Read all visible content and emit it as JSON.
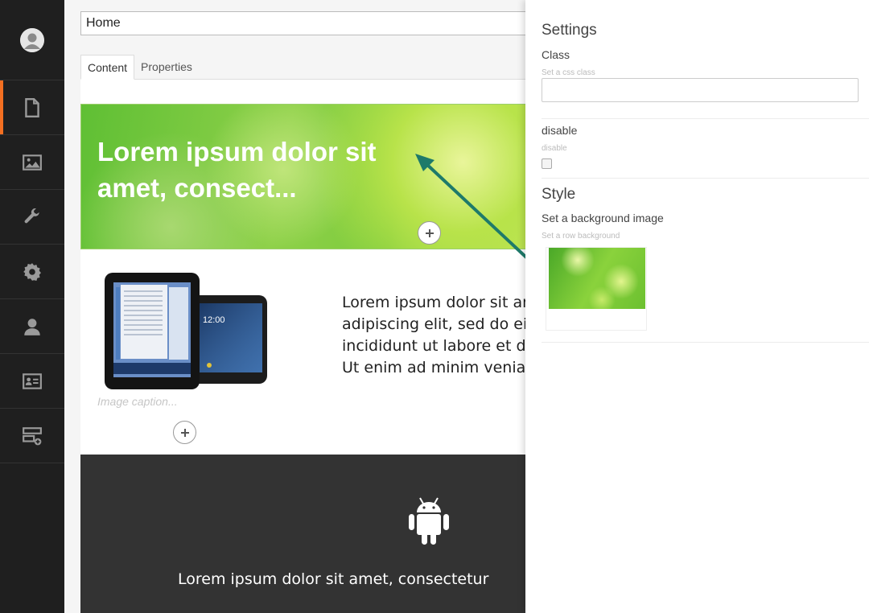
{
  "page": {
    "name_value": "Home",
    "tabs": [
      {
        "label": "Content"
      },
      {
        "label": "Properties"
      }
    ]
  },
  "sidebar": {
    "items": [
      {
        "icon": "document-icon"
      },
      {
        "icon": "image-icon"
      },
      {
        "icon": "wrench-icon"
      },
      {
        "icon": "gear-icon"
      },
      {
        "icon": "user-icon"
      },
      {
        "icon": "id-card-icon"
      },
      {
        "icon": "add-form-icon"
      }
    ],
    "accent_color": "#f36f21"
  },
  "content": {
    "hero_title": "Lorem ipsum dolor sit amet, consect...",
    "image_caption": "Image caption...",
    "text_lines": [
      "Lorem ipsum dolor sit amet, consectetur",
      "adipiscing elit, sed do eiusmod tempor",
      "incididunt ut labore et dolore magna aliqua.",
      "Ut enim ad minim veniam, quis nostrud"
    ],
    "dark_text": "Lorem ipsum dolor sit amet, consectetur"
  },
  "settings": {
    "title": "Settings",
    "class_label": "Class",
    "class_hint": "Set a css class",
    "class_value": "",
    "disable_label": "disable",
    "disable_hint": "disable",
    "disable_checked": false,
    "style_title": "Style",
    "bg_label": "Set a background image",
    "bg_hint": "Set a row background"
  }
}
